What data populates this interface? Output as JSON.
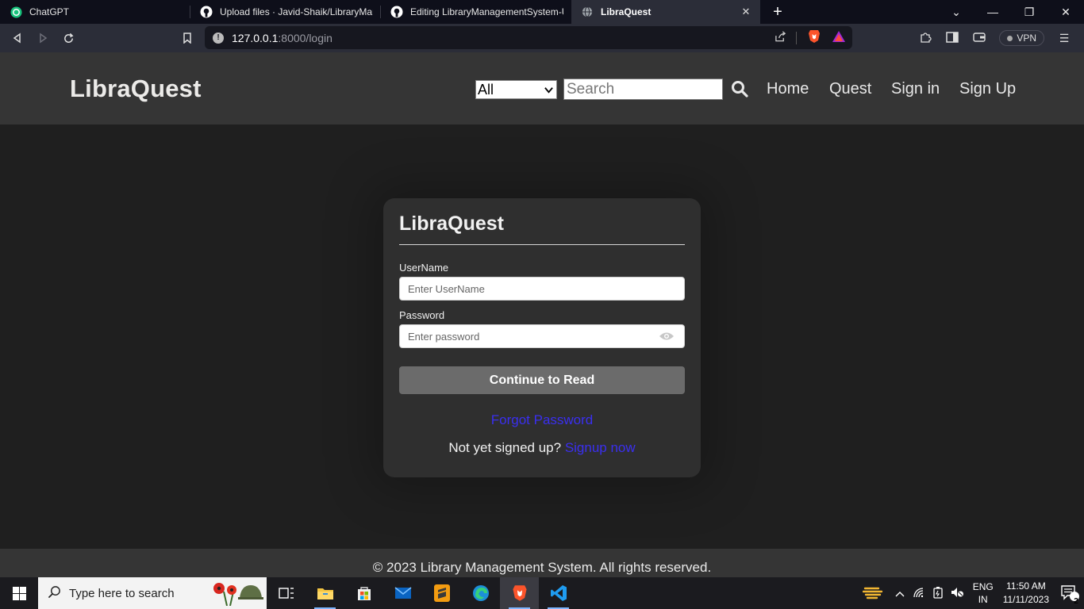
{
  "browser": {
    "tabs": [
      {
        "title": "ChatGPT",
        "icon": "chatgpt-icon",
        "active": false
      },
      {
        "title": "Upload files · Javid-Shaik/LibraryMana",
        "icon": "github-icon",
        "active": false
      },
      {
        "title": "Editing LibraryManagementSystem-Us",
        "icon": "github-icon",
        "active": false
      },
      {
        "title": "LibraQuest",
        "icon": "globe-icon",
        "active": true
      }
    ],
    "new_tab": "+",
    "url_host": "127.0.0.1",
    "url_path": ":8000/login",
    "vpn_label": "VPN"
  },
  "site": {
    "brand": "LibraQuest",
    "search_category": "All",
    "search_placeholder": "Search",
    "nav": [
      "Home",
      "Quest",
      "Sign in",
      "Sign Up"
    ]
  },
  "login": {
    "title": "LibraQuest",
    "username_label": "UserName",
    "username_placeholder": "Enter UserName",
    "password_label": "Password",
    "password_placeholder": "Enter password",
    "submit_label": "Continue to Read",
    "forgot_label": "Forgot Password",
    "signup_prompt": "Not yet signed up? ",
    "signup_link": "Signup now"
  },
  "footer": {
    "text": "© 2023 Library Management System. All rights reserved."
  },
  "taskbar": {
    "search_placeholder": "Type here to search",
    "lang_top": "ENG",
    "lang_bottom": "IN",
    "time": "11:50 AM",
    "date": "11/11/2023",
    "notification_count": "2"
  },
  "colors": {
    "page_bg": "#1f1f1f",
    "header_bg": "#353535",
    "card_bg": "#2f2f2f",
    "button_bg": "#6b6b6b",
    "link": "#3a2ff0"
  }
}
